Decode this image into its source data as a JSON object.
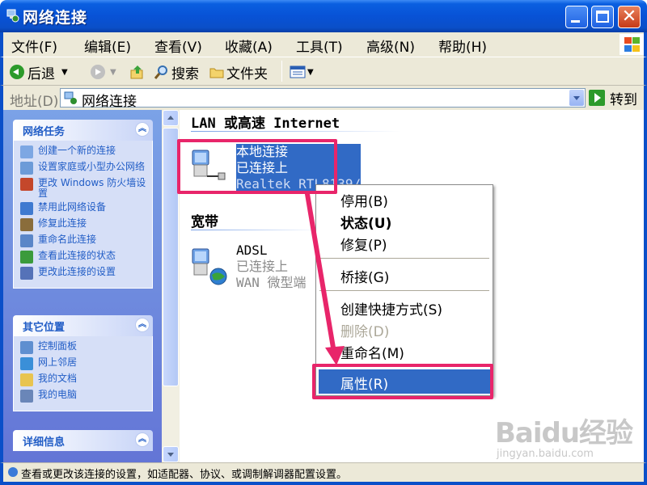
{
  "window": {
    "title": "网络连接"
  },
  "menubar": [
    "文件(F)",
    "编辑(E)",
    "查看(V)",
    "收藏(A)",
    "工具(T)",
    "高级(N)",
    "帮助(H)"
  ],
  "toolbar": {
    "back": "后退",
    "search": "搜索",
    "folders": "文件夹"
  },
  "address": {
    "label": "地址(D)",
    "value": "网络连接",
    "go": "转到"
  },
  "taskpane": {
    "network_tasks": {
      "title": "网络任务",
      "items": [
        "创建一个新的连接",
        "设置家庭或小型办公网络",
        "更改 Windows 防火墙设置",
        "禁用此网络设备",
        "修复此连接",
        "重命名此连接",
        "查看此连接的状态",
        "更改此连接的设置"
      ]
    },
    "other_places": {
      "title": "其它位置",
      "items": [
        "控制面板",
        "网上邻居",
        "我的文档",
        "我的电脑"
      ]
    },
    "details": {
      "title": "详细信息"
    }
  },
  "content": {
    "lan_group": "LAN 或高速 Internet",
    "lan_conn": {
      "name": "本地连接",
      "status": "已连接上",
      "device": "Realtek RTL8139/"
    },
    "broadband_group": "宽带",
    "adsl_conn": {
      "name": "ADSL",
      "status": "已连接上",
      "device": "WAN 微型端"
    }
  },
  "context_menu": {
    "items": [
      "停用(B)",
      "状态(U)",
      "修复(P)",
      "桥接(G)",
      "创建快捷方式(S)",
      "删除(D)",
      "重命名(M)",
      "属性(R)"
    ],
    "selected": "属性(R)",
    "default_item": "状态(U)",
    "disabled_item": "删除(D)"
  },
  "statusbar": {
    "text": "查看或更改该连接的设置，如适配器、协议、或调制解调器配置设置。"
  },
  "watermark": {
    "brand": "Baidu经验",
    "url": "jingyan.baidu.com"
  },
  "colors": {
    "highlight": "#e8256a",
    "selection": "#316ac5",
    "titlebar": "#0a4fc9"
  }
}
